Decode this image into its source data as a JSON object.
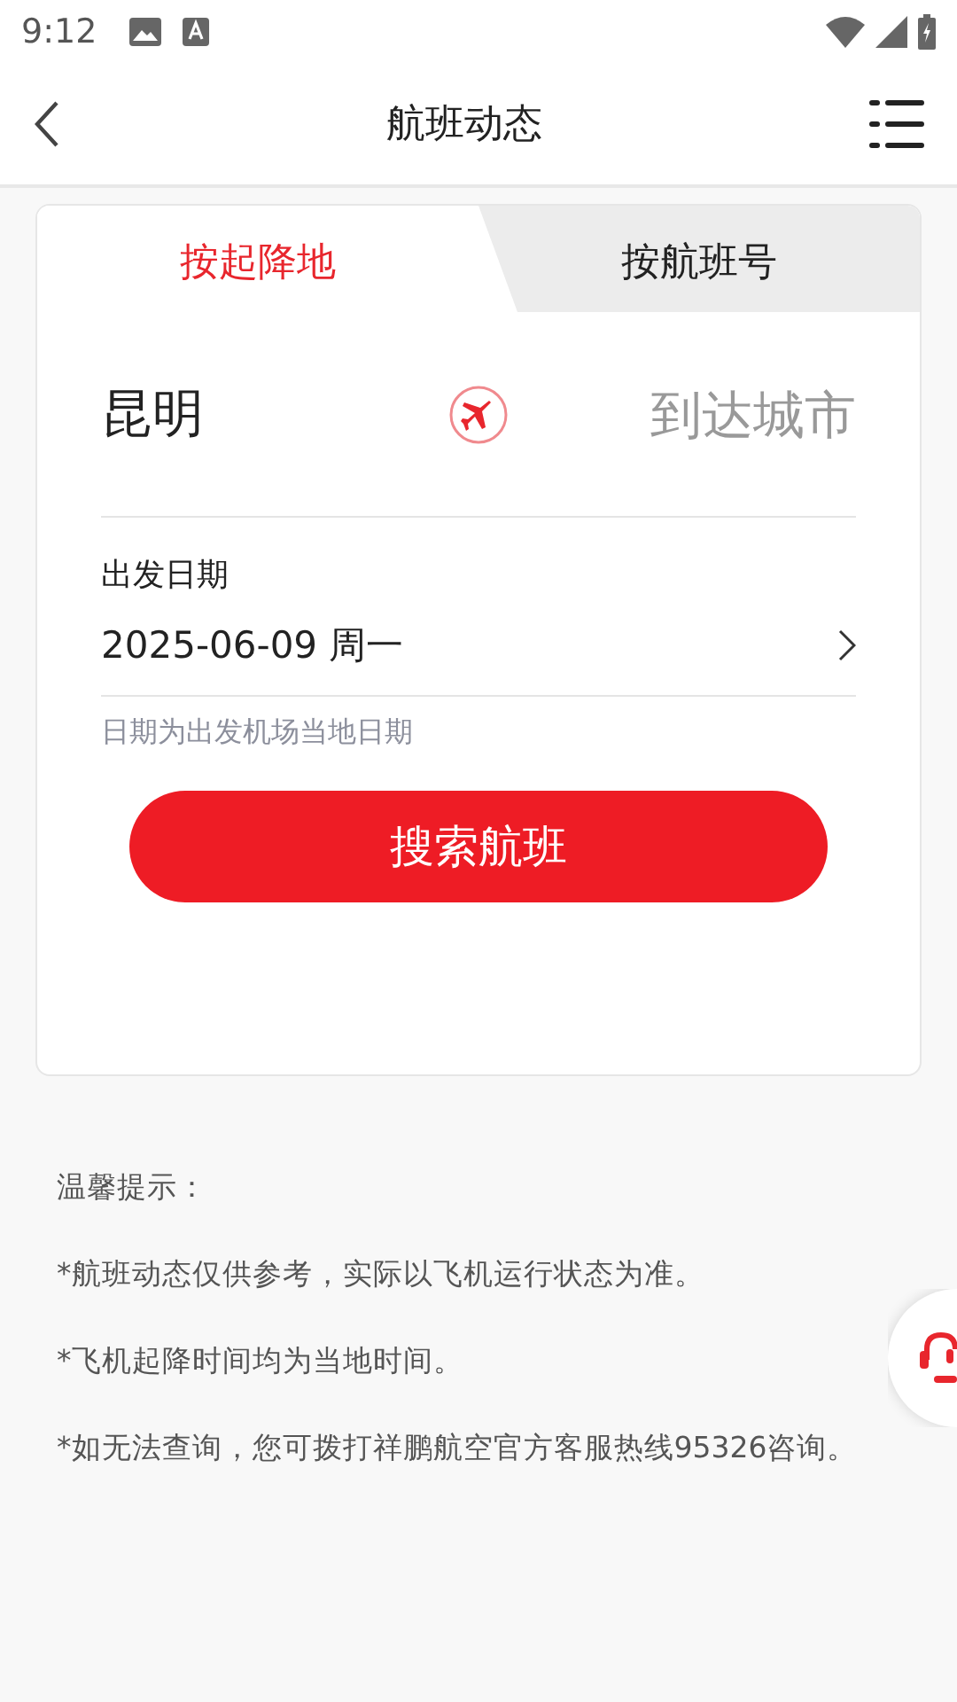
{
  "status_bar": {
    "time": "9:12"
  },
  "header": {
    "title": "航班动态"
  },
  "tabs": [
    {
      "label": "按起降地",
      "selected": true
    },
    {
      "label": "按航班号",
      "selected": false
    }
  ],
  "route": {
    "from": {
      "value": "昆明"
    },
    "to": {
      "placeholder": "到达城市"
    }
  },
  "date": {
    "label": "出发日期",
    "value": "2025-06-09 周一",
    "note": "日期为出发机场当地日期"
  },
  "search_button": "搜索航班",
  "tips": {
    "title": "温馨提示：",
    "lines": [
      "*航班动态仅供参考，实际以飞机运行状态为准。",
      "*飞机起降时间均为当地时间。",
      "*如无法查询，您可拨打祥鹏航空官方客服热线95326咨询。"
    ]
  }
}
